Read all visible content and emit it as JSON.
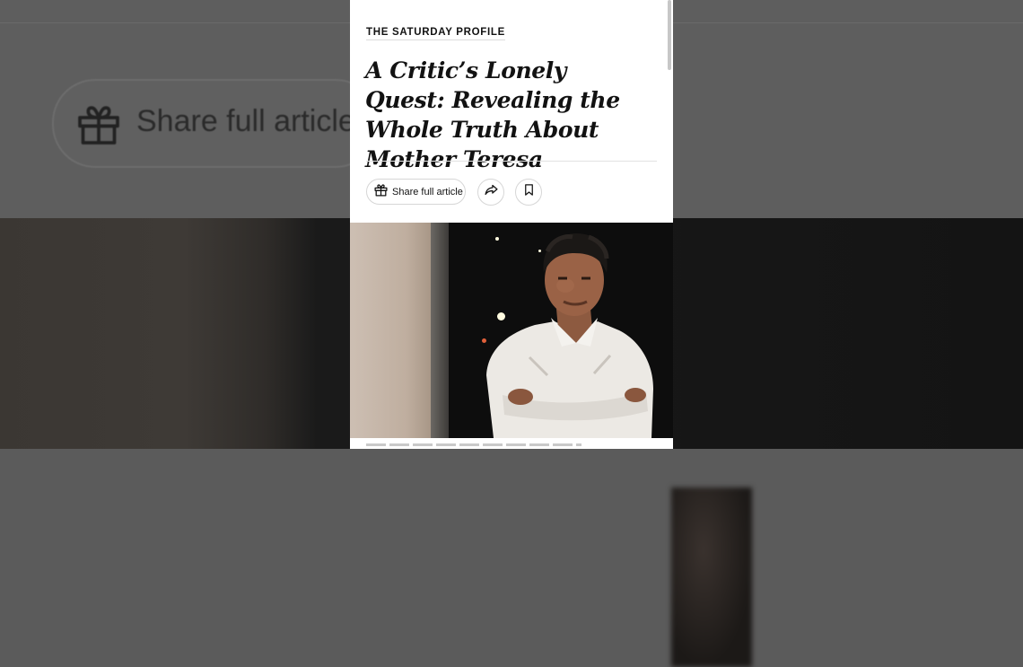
{
  "background": {
    "share_label": "Share full article"
  },
  "article": {
    "kicker": "THE SATURDAY PROFILE",
    "headline": "A Critic’s Lonely Quest: Revealing the Whole Truth About Mother Teresa",
    "share_label": "Share full article",
    "icons": {
      "gift": "gift-icon",
      "share": "share-arrow-icon",
      "bookmark": "bookmark-icon"
    }
  },
  "colors": {
    "panel": "#ffffff",
    "text": "#121212",
    "border": "#d6d6d6",
    "backdrop": "#5e5e5e"
  }
}
